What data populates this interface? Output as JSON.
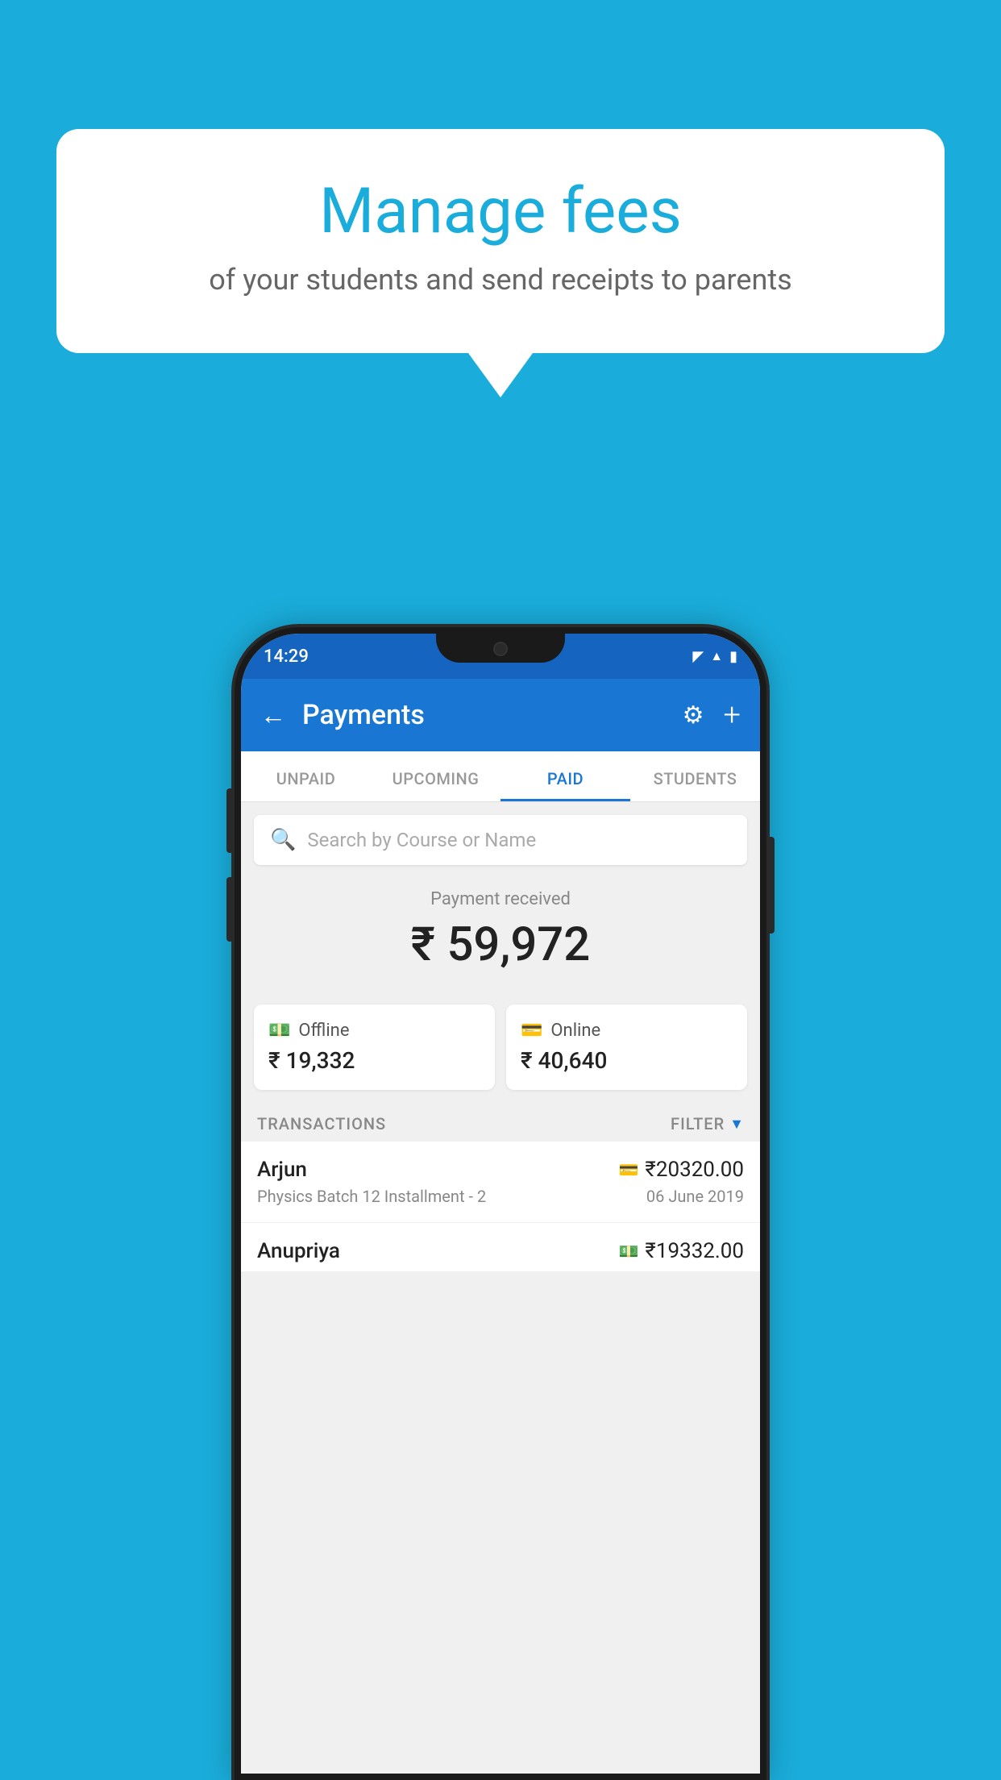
{
  "background_color": "#1AADDB",
  "speech_bubble": {
    "title": "Manage fees",
    "subtitle": "of your students and send receipts to parents"
  },
  "status_bar": {
    "time": "14:29",
    "icons": [
      "wifi",
      "signal",
      "battery"
    ]
  },
  "app_bar": {
    "title": "Payments",
    "back_label": "←",
    "settings_label": "⚙",
    "add_label": "+"
  },
  "tabs": [
    {
      "label": "UNPAID",
      "active": false
    },
    {
      "label": "UPCOMING",
      "active": false
    },
    {
      "label": "PAID",
      "active": true
    },
    {
      "label": "STUDENTS",
      "active": false
    }
  ],
  "search": {
    "placeholder": "Search by Course or Name"
  },
  "payment_summary": {
    "label": "Payment received",
    "total": "₹ 59,972",
    "offline_label": "Offline",
    "offline_amount": "₹ 19,332",
    "online_label": "Online",
    "online_amount": "₹ 40,640"
  },
  "transactions": {
    "header": "TRANSACTIONS",
    "filter": "FILTER",
    "items": [
      {
        "name": "Arjun",
        "course": "Physics Batch 12 Installment - 2",
        "amount": "₹20320.00",
        "date": "06 June 2019",
        "payment_type": "card"
      },
      {
        "name": "Anupriya",
        "amount": "₹19332.00",
        "payment_type": "cash",
        "partial": true
      }
    ]
  }
}
